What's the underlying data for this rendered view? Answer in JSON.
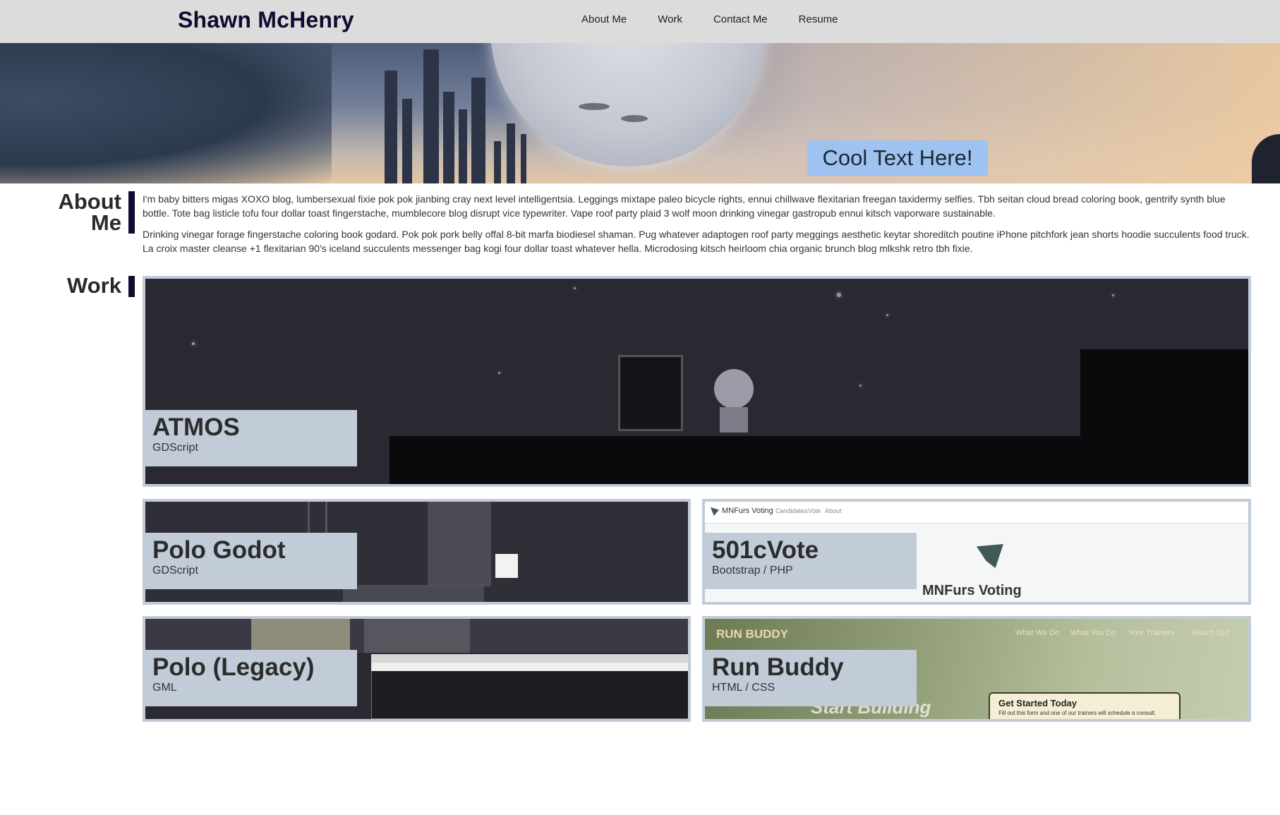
{
  "header": {
    "brand": "Shawn McHenry",
    "nav": [
      "About Me",
      "Work",
      "Contact Me",
      "Resume"
    ]
  },
  "hero": {
    "cta": "Cool Text Here!"
  },
  "about": {
    "title": "About Me",
    "paragraphs": [
      "I'm baby bitters migas XOXO blog, lumbersexual fixie pok pok jianbing cray next level intelligentsia. Leggings mixtape paleo bicycle rights, ennui chillwave flexitarian freegan taxidermy selfies. Tbh seitan cloud bread coloring book, gentrify synth blue bottle. Tote bag listicle tofu four dollar toast fingerstache, mumblecore blog disrupt vice typewriter. Vape roof party plaid 3 wolf moon drinking vinegar gastropub ennui kitsch vaporware sustainable.",
      "Drinking vinegar forage fingerstache coloring book godard. Pok pok pork belly offal 8-bit marfa biodiesel shaman. Pug whatever adaptogen roof party meggings aesthetic keytar shoreditch poutine iPhone pitchfork jean shorts hoodie succulents food truck. La croix master cleanse +1 flexitarian 90's iceland succulents messenger bag kogi four dollar toast whatever hella. Microdosing kitsch heirloom chia organic brunch blog mlkshk retro tbh fixie."
    ]
  },
  "work": {
    "title": "Work",
    "projects": [
      {
        "name": "ATMOS",
        "tech": "GDScript"
      },
      {
        "name": "Polo Godot",
        "tech": "GDScript"
      },
      {
        "name": "501cVote",
        "tech": "Bootstrap / PHP"
      },
      {
        "name": "Polo (Legacy)",
        "tech": "GML"
      },
      {
        "name": "Run Buddy",
        "tech": "HTML / CSS"
      }
    ],
    "screens": {
      "vote_nav": [
        "MNFurs Voting",
        "Candidates",
        "Vote",
        "About"
      ],
      "vote_logo": "MNFurs Voting",
      "run_brand": "RUN BUDDY",
      "run_nav": [
        "What We Do",
        "What You Do",
        "Your Trainers",
        "Reach Out"
      ],
      "run_hero": "Start Building",
      "run_cta_title": "Get Started Today",
      "run_cta_sub": "Fill out this form and one of our trainers will schedule a consult."
    }
  },
  "colors": {
    "header_bg": "#dcdcdc",
    "brand": "#0e0b30",
    "accent_bar": "#0e0b30",
    "card_frame": "#c2ccd9",
    "cta_bg": "#9ec3f0"
  }
}
